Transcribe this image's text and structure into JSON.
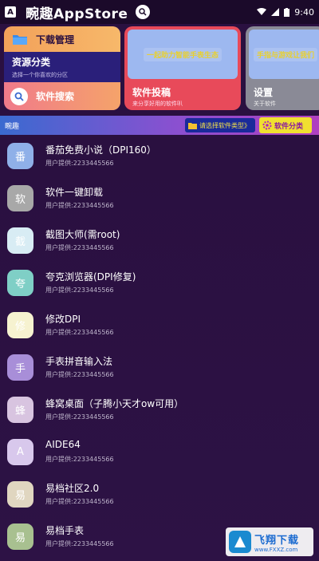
{
  "statusbar": {
    "time": "9:40",
    "app_title": "畹趣AppStore"
  },
  "tiles": {
    "download": "下载管理",
    "resources": "资源分类",
    "resources_sub": "选择一个你喜欢的分区",
    "search": "软件搜索",
    "submit": "软件投稿",
    "submit_sub": "来分享好用的软件叭",
    "submit_banner": "一起助力智能手表生态",
    "settings": "设置",
    "settings_sub": "关于软件",
    "settings_banner": "手指与游戏让我们"
  },
  "section": {
    "title": "畹趣",
    "type_chip": "请选择软件类型》",
    "category_chip": "软件分类"
  },
  "apps": [
    {
      "icon_text": "番",
      "name": "番茄免费小说（DPI160）",
      "user": "用户提供:2233445566",
      "color": "#8fb0e8"
    },
    {
      "icon_text": "软",
      "name": "软件一键卸载",
      "user": "用户提供:2233445566",
      "color": "#a8a8a8"
    },
    {
      "icon_text": "截",
      "name": "截图大师(需root)",
      "user": "用户提供:2233445566",
      "color": "#d8ecf4"
    },
    {
      "icon_text": "夸",
      "name": "夸克浏览器(DPI修复)",
      "user": "用户提供:2233445566",
      "color": "#7fcfc6"
    },
    {
      "icon_text": "修",
      "name": "修改DPI",
      "user": "用户提供:2233445566",
      "color": "#f6f2d0"
    },
    {
      "icon_text": "手",
      "name": "手表拼音输入法",
      "user": "用户提供:2233445566",
      "color": "#a88ed8"
    },
    {
      "icon_text": "蜂",
      "name": "蜂窝桌面（子腾小天才ow可用）",
      "user": "用户提供:2233445566",
      "color": "#d8c4e0"
    },
    {
      "icon_text": "A",
      "name": "AIDE64",
      "user": "用户提供:2233445566",
      "color": "#d8c8ec"
    },
    {
      "icon_text": "易",
      "name": "易档社区2.0",
      "user": "用户提供:2233445566",
      "color": "#e0d6c0"
    },
    {
      "icon_text": "易",
      "name": "易档手表",
      "user": "用户提供:2233445566",
      "color": "#a8c090"
    }
  ],
  "watermark": {
    "title": "飞翔下载",
    "url": "www.FXXZ.com"
  }
}
